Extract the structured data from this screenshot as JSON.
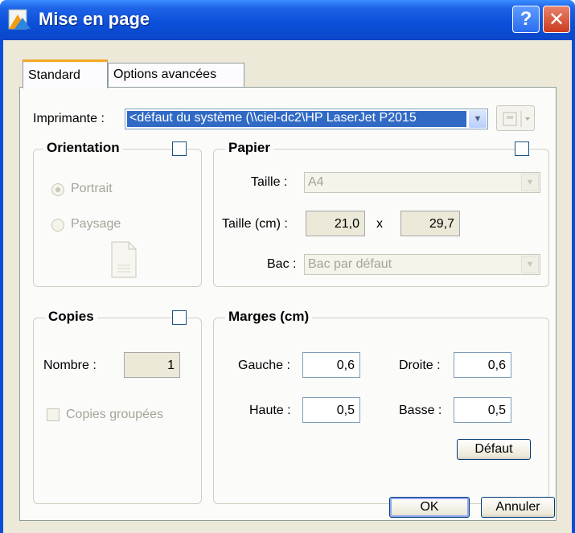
{
  "window": {
    "title": "Mise en page",
    "help_label": "?",
    "close_label": "✕"
  },
  "tabs": [
    {
      "label": "Standard",
      "active": true
    },
    {
      "label": "Options avancées",
      "active": false
    }
  ],
  "printer": {
    "label": "Imprimante :",
    "value": "<défaut du système (\\\\ciel-dc2\\HP LaserJet P2015"
  },
  "orientation": {
    "title": "Orientation",
    "portrait_label": "Portrait",
    "landscape_label": "Paysage",
    "selected": "Portrait"
  },
  "paper": {
    "title": "Papier",
    "size_label": "Taille :",
    "size_value": "A4",
    "size_cm_label": "Taille (cm) :",
    "width": "21,0",
    "x_label": "x",
    "height": "29,7",
    "tray_label": "Bac :",
    "tray_value": "Bac par défaut"
  },
  "copies": {
    "title": "Copies",
    "number_label": "Nombre :",
    "number_value": "1",
    "collate_label": "Copies groupées"
  },
  "margins": {
    "title": "Marges (cm)",
    "left_label": "Gauche :",
    "left_value": "0,6",
    "right_label": "Droite :",
    "right_value": "0,6",
    "top_label": "Haute :",
    "top_value": "0,5",
    "bottom_label": "Basse :",
    "bottom_value": "0,5",
    "default_button": "Défaut"
  },
  "footer": {
    "ok_label": "OK",
    "cancel_label": "Annuler"
  },
  "colors": {
    "titlebar": "#0a4ed8",
    "selection": "#316ac5",
    "tab_highlight": "#f5a623"
  }
}
